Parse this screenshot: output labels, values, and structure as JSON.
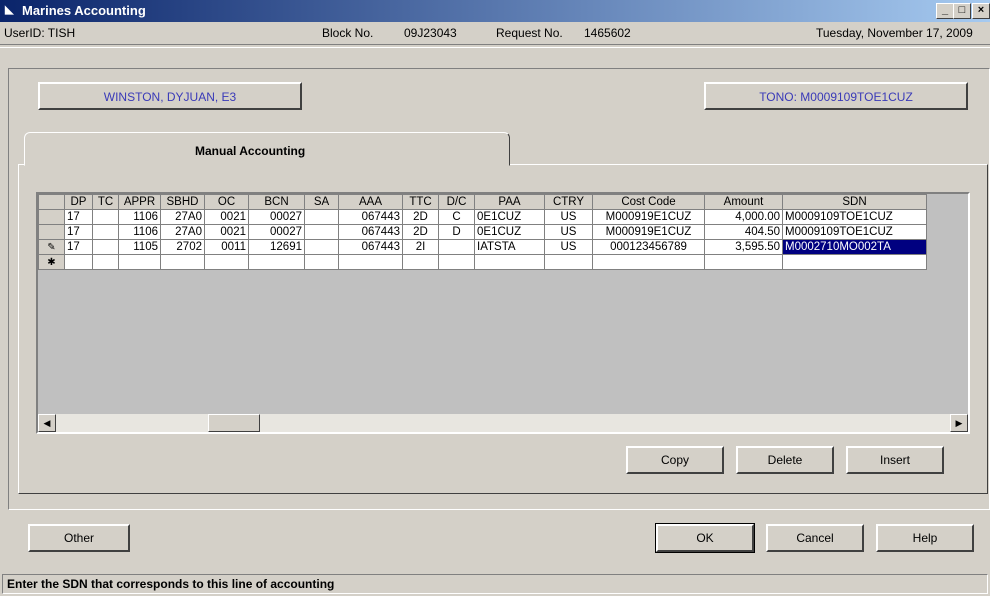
{
  "window": {
    "title": "Marines Accounting",
    "min": "_",
    "max": "□",
    "close": "×"
  },
  "info": {
    "userid": "UserID: TISH",
    "block_label": "Block No.",
    "block_value": "09J23043",
    "request_label": "Request No.",
    "request_value": "1465602",
    "date": "Tuesday, November 17, 2009"
  },
  "header_buttons": {
    "member": "WINSTON, DYJUAN, E3",
    "tono": "TONO: M0009109TOE1CUZ"
  },
  "tab": {
    "label": "Manual Accounting"
  },
  "grid": {
    "columns": [
      "DP",
      "TC",
      "APPR",
      "SBHD",
      "OC",
      "BCN",
      "SA",
      "AAA",
      "TTC",
      "D/C",
      "PAA",
      "CTRY",
      "Cost Code",
      "Amount",
      "SDN"
    ],
    "rows": [
      {
        "marker": "",
        "cells": [
          "17",
          "",
          "1106",
          "27A0",
          "0021",
          "00027",
          "",
          "067443",
          "2D",
          "C",
          "0E1CUZ",
          "US",
          "M000919E1CUZ",
          "4,000.00",
          "M0009109TOE1CUZ"
        ]
      },
      {
        "marker": "",
        "cells": [
          "17",
          "",
          "1106",
          "27A0",
          "0021",
          "00027",
          "",
          "067443",
          "2D",
          "D",
          "0E1CUZ",
          "US",
          "M000919E1CUZ",
          "404.50",
          "M0009109TOE1CUZ"
        ]
      },
      {
        "marker": "✎",
        "cells": [
          "17",
          "",
          "1105",
          "2702",
          "0011",
          "12691",
          "",
          "067443",
          "2I",
          "",
          "IATSTA",
          "US",
          "000123456789",
          "3,595.50",
          "M0002710MO002TA"
        ]
      },
      {
        "marker": "✱",
        "cells": [
          "",
          "",
          "",
          "",
          "",
          "",
          "",
          "",
          "",
          "",
          "",
          "",
          "",
          "",
          ""
        ]
      }
    ]
  },
  "grid_buttons": {
    "copy": "Copy",
    "delete": "Delete",
    "insert": "Insert"
  },
  "bottom_buttons": {
    "other": "Other",
    "ok": "OK",
    "cancel": "Cancel",
    "help": "Help"
  },
  "status": {
    "text": "Enter the SDN that corresponds to this line of accounting"
  }
}
